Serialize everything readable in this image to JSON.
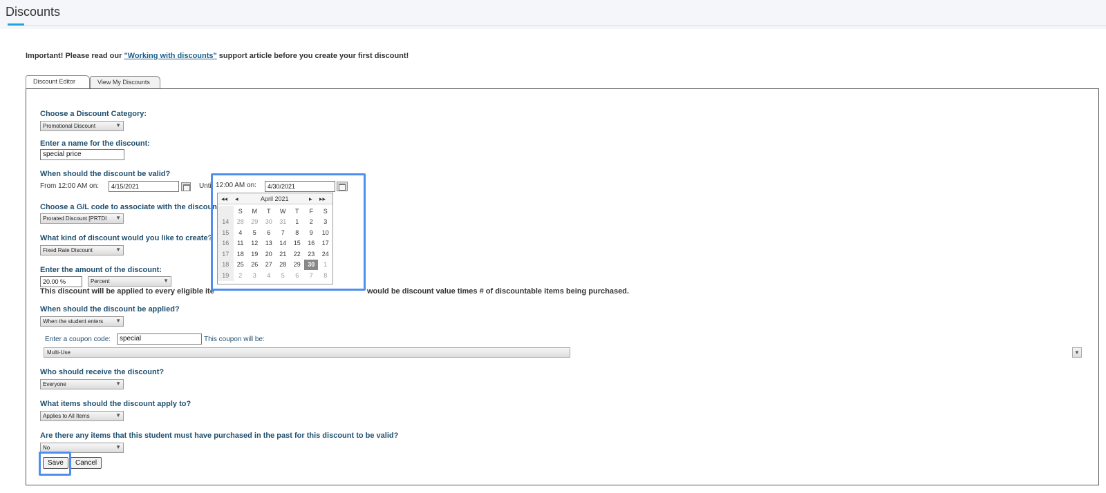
{
  "page": {
    "title": "Discounts"
  },
  "notice": {
    "prefix": "Important! Please read our ",
    "link": "\"Working with discounts\"",
    "suffix": " support article before you create your first discount!"
  },
  "tabs": [
    {
      "label": "Discount Editor",
      "active": true
    },
    {
      "label": "View My Discounts",
      "active": false
    }
  ],
  "form": {
    "category_label": "Choose a Discount Category:",
    "category_value": "Promotional Discount",
    "name_label": "Enter a name for the discount:",
    "name_value": "special price",
    "valid_label": "When should the discount be valid?",
    "from_label": "From 12:00 AM on:",
    "from_date": "4/15/2021",
    "until_label_a": "Unti",
    "until_label_b": "12:00 AM on:",
    "until_date": "4/30/2021",
    "gl_label": "Choose a G/L code to associate with the discount (",
    "gl_value": "Prorated Discount [PRTDI",
    "kind_label": "What kind of discount would you like to create?",
    "kind_value": "Fixed Rate Discount",
    "amount_label": "Enter the amount of the discount:",
    "amount_value": "20.00 %",
    "amount_unit": "Percent",
    "amount_note_a": "This discount will be applied to every eligible ite",
    "amount_note_b": "would be discount value times # of discountable items being purchased.",
    "applied_label": "When should the discount be applied?",
    "applied_value": "When the student enters",
    "coupon_label": "Enter a coupon code:",
    "coupon_value": "special",
    "coupon_will_be": "This coupon will be:",
    "coupon_use": "Multi-Use",
    "receive_label": "Who should receive the discount?",
    "receive_value": "Everyone",
    "items_label": "What items should the discount apply to?",
    "items_value": "Applies to All Items",
    "past_label": "Are there any items that this student must have purchased in the past for this discount to be valid?",
    "past_value": "No",
    "save_label": "Save",
    "cancel_label": "Cancel"
  },
  "calendar": {
    "title": "April 2021",
    "nav": {
      "prev_year": "◂◂",
      "prev_month": "◂",
      "next_month": "▸",
      "next_year": "▸▸"
    },
    "weekdays": [
      "S",
      "M",
      "T",
      "W",
      "T",
      "F",
      "S"
    ],
    "weeks": [
      {
        "wk": "14",
        "days": [
          "28",
          "29",
          "30",
          "31",
          "1",
          "2",
          "3"
        ]
      },
      {
        "wk": "15",
        "days": [
          "4",
          "5",
          "6",
          "7",
          "8",
          "9",
          "10"
        ]
      },
      {
        "wk": "16",
        "days": [
          "11",
          "12",
          "13",
          "14",
          "15",
          "16",
          "17"
        ]
      },
      {
        "wk": "17",
        "days": [
          "18",
          "19",
          "20",
          "21",
          "22",
          "23",
          "24"
        ]
      },
      {
        "wk": "18",
        "days": [
          "25",
          "26",
          "27",
          "28",
          "29",
          "30",
          "1"
        ]
      },
      {
        "wk": "19",
        "days": [
          "2",
          "3",
          "4",
          "5",
          "6",
          "7",
          "8"
        ]
      }
    ],
    "selected": "30"
  }
}
